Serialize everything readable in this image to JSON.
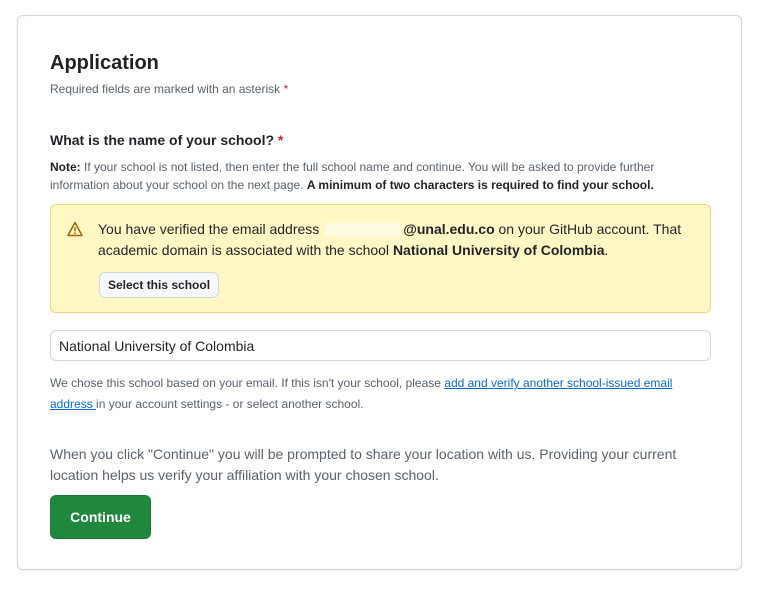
{
  "header": {
    "title": "Application",
    "required_note": "Required fields are marked with an asterisk",
    "asterisk": "*"
  },
  "school_question": {
    "label": "What is the name of your school?",
    "asterisk": "*",
    "note_label": "Note:",
    "note_text": " If your school is not listed, then enter the full school name and continue. You will be asked to provide further information about your school on the next page. ",
    "note_emphasis": "A minimum of two characters is required to find your school."
  },
  "flash": {
    "icon": "alert-icon",
    "text_before": "You have verified the email address ",
    "email_domain": "@unal.edu.co",
    "text_middle": " on your GitHub account. That academic domain is associated with the school ",
    "school_name": "National University of Colombia",
    "text_end": ".",
    "button_label": "Select this school"
  },
  "school_input": {
    "value": "National University of Colombia"
  },
  "chosen_note": {
    "text_before": "We chose this school based on your email. If this isn't your school, please ",
    "link_text": "add and verify another school-issued email address ",
    "text_after": "in your account settings - or select another school."
  },
  "location_note": {
    "text": "When you click \"Continue\" you will be prompted to share your location with us. Providing your current location helps us verify your affiliation with your chosen school."
  },
  "actions": {
    "continue_label": "Continue"
  },
  "colors": {
    "primary_button": "#1f883d",
    "flash_background": "#fff8c5",
    "link": "#0969da",
    "required": "#d1242f"
  }
}
